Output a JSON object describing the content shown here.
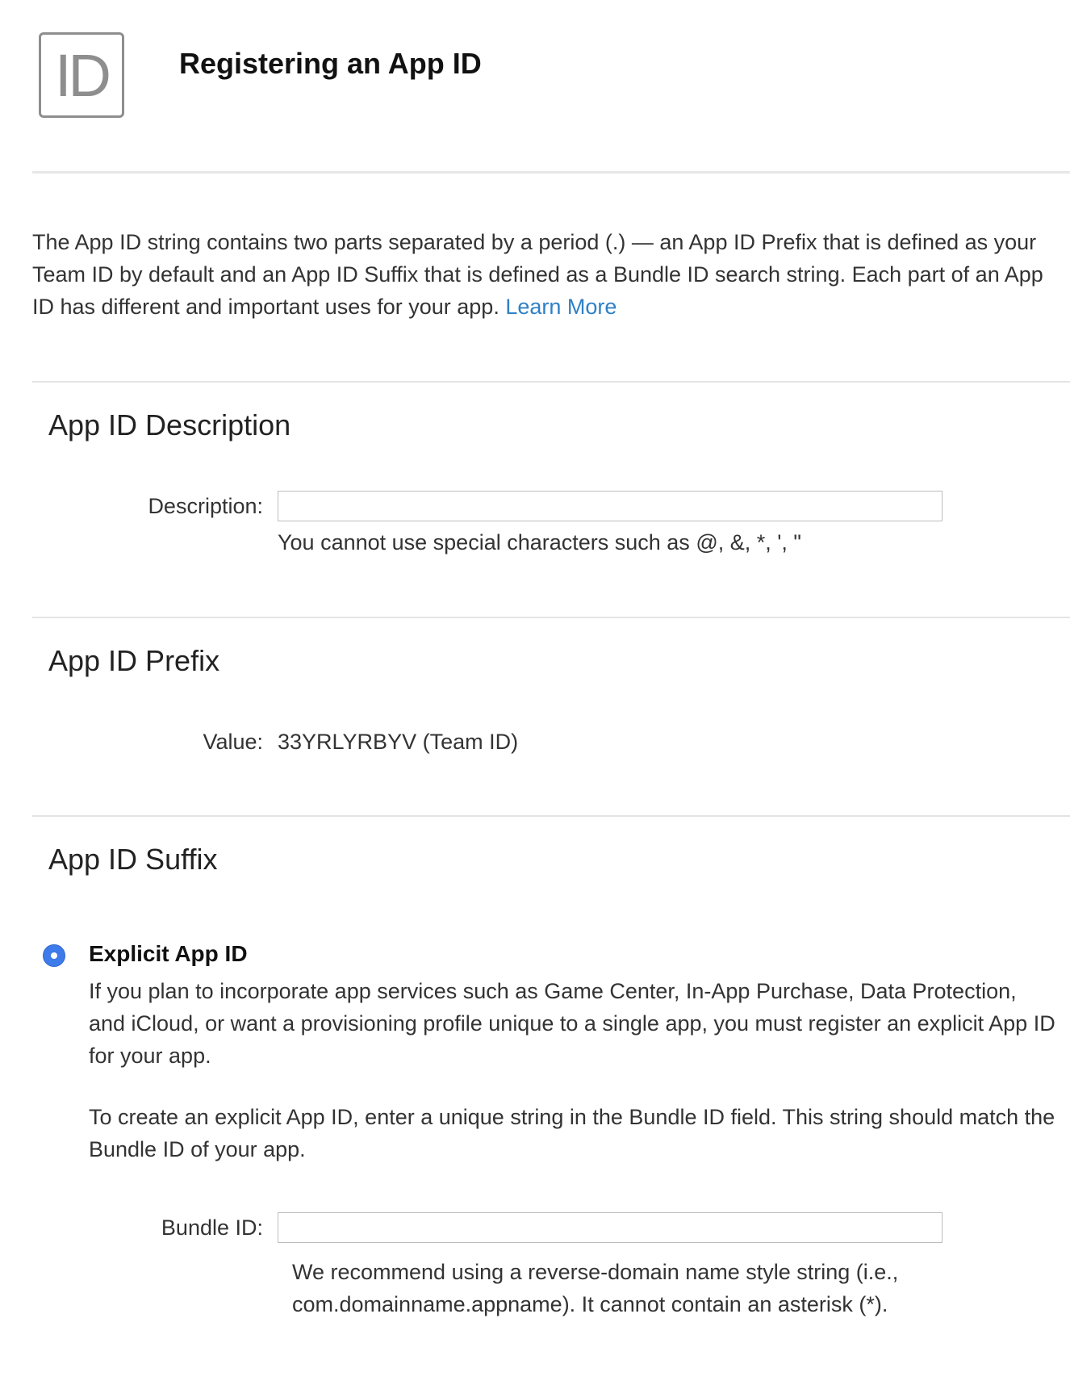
{
  "header": {
    "badge_text": "ID",
    "title": "Registering an App ID"
  },
  "intro": {
    "text": "The App ID string contains two parts separated by a period (.) — an App ID Prefix that is defined as your Team ID by default and an App ID Suffix that is defined as a Bundle ID search string. Each part of an App ID has different and important uses for your app.",
    "learn_more": "Learn More"
  },
  "description_section": {
    "title": "App ID Description",
    "label": "Description:",
    "value": "",
    "placeholder": "",
    "hint": "You cannot use special characters such as @, &, *, ', \""
  },
  "prefix_section": {
    "title": "App ID Prefix",
    "label": "Value:",
    "value": "33YRLYRBYV (Team ID)"
  },
  "suffix_section": {
    "title": "App ID Suffix",
    "option": {
      "label": "Explicit App ID",
      "selected": true,
      "paragraph1": "If you plan to incorporate app services such as Game Center, In-App Purchase, Data Protection, and iCloud, or want a provisioning profile unique to a single app, you must register an explicit App ID for your app.",
      "paragraph2": "To create an explicit App ID, enter a unique string in the Bundle ID field. This string should match the Bundle ID of your app."
    },
    "bundle_label": "Bundle ID:",
    "bundle_value": "",
    "bundle_placeholder": "",
    "bundle_hint": "We recommend using a reverse-domain name style string (i.e., com.domainname.appname). It cannot contain an asterisk (*)."
  },
  "colors": {
    "link": "#2f80c6",
    "radio_selected": "#3d7bea",
    "badge_border": "#8e8e8e"
  }
}
